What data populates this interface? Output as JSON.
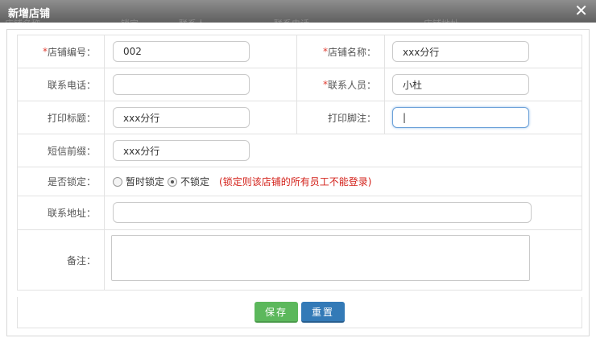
{
  "dialog": {
    "title": "新增店铺",
    "close": "✕"
  },
  "background_table": {
    "headers": [
      "店铺名称",
      "锁定",
      "联系人",
      "联系电话",
      "店铺地址"
    ]
  },
  "form": {
    "store_no": {
      "required": "*",
      "label": "店铺编号：",
      "value": "002"
    },
    "store_name": {
      "required": "*",
      "label": "店铺名称：",
      "value": "xxx分行"
    },
    "phone": {
      "label": "联系电话：",
      "value": ""
    },
    "contact": {
      "required": "*",
      "label": "联系人员：",
      "value": "小杜"
    },
    "print_title": {
      "label": "打印标题：",
      "value": "xxx分行"
    },
    "print_footer": {
      "label": "打印脚注：",
      "value": "|"
    },
    "sms_prefix": {
      "label": "短信前缀：",
      "value": "xxx分行"
    },
    "locked": {
      "label": "是否锁定：",
      "options": [
        "暂时锁定",
        "不锁定"
      ],
      "selected": "不锁定",
      "hint": "(锁定则该店铺的所有员工不能登录)"
    },
    "address": {
      "label": "联系地址：",
      "value": ""
    },
    "remark": {
      "label": "备注：",
      "value": ""
    }
  },
  "buttons": {
    "save": "保存",
    "reset": "重置"
  },
  "colors": {
    "save": "#5cb85c",
    "reset": "#337ab7",
    "required": "#e03c31",
    "hint": "#d3211a"
  }
}
